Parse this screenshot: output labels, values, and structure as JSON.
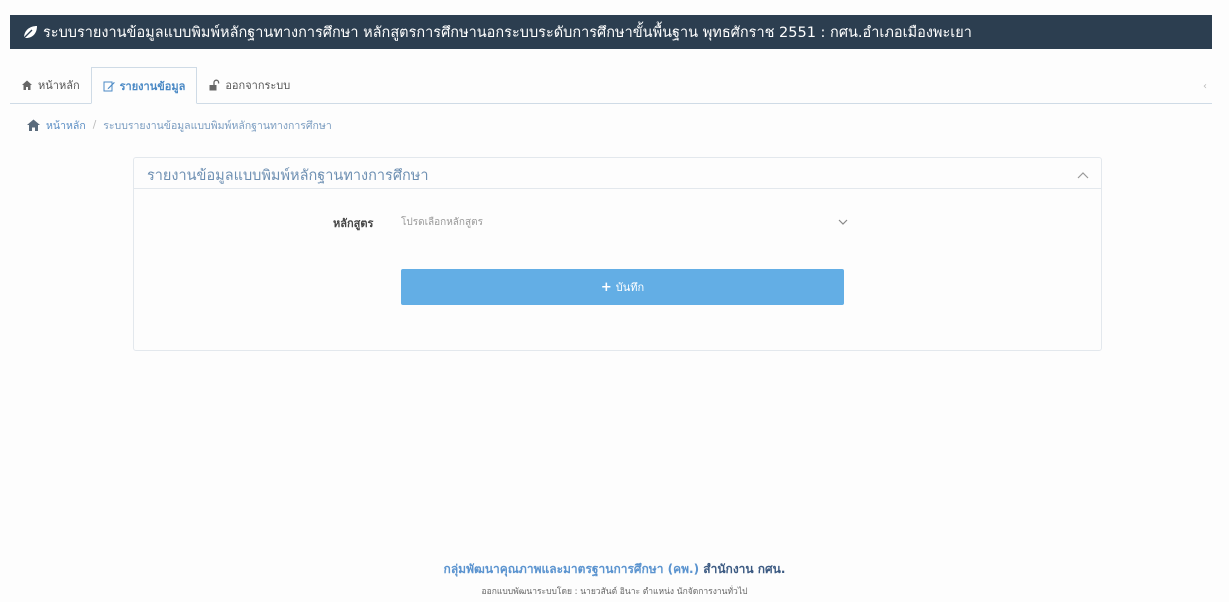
{
  "header": {
    "title": "ระบบรายงานข้อมูลแบบพิมพ์หลักฐานทางการศึกษา หลักสูตรการศึกษานอกระบบระดับการศึกษาขั้นพื้นฐาน พุทธศักราช 2551 : กศน.อำเภอเมืองพะเยา",
    "icon": "leaf-icon",
    "background": "#2c3e50"
  },
  "tabs": [
    {
      "label": "หน้าหลัก",
      "icon": "home-icon",
      "active": false
    },
    {
      "label": "รายงานข้อมูล",
      "icon": "edit-icon",
      "active": true
    },
    {
      "label": "ออกจากระบบ",
      "icon": "unlock-icon",
      "active": false
    }
  ],
  "breadcrumb": {
    "home": "หน้าหลัก",
    "separator": "/",
    "current": "ระบบรายงานข้อมูลแบบพิมพ์หลักฐานทางการศึกษา"
  },
  "panel": {
    "title": "รายงานข้อมูลแบบพิมพ์หลักฐานทางการศึกษา",
    "collapse_icon": "chevron-up-icon",
    "form": {
      "curriculum_label": "หลักสูตร",
      "curriculum_placeholder": "โปรดเลือกหลักสูตร"
    },
    "save_button": {
      "icon": "+",
      "label": "บันทึก",
      "color": "#63aee5"
    }
  },
  "footer": {
    "org": "กลุ่มพัฒนาคุณภาพและมาตรฐานการศึกษา (คพ.)",
    "office": "สำนักงาน กศน.",
    "credit": "ออกแบบพัฒนาระบบโดย : นายวสันต์ อินาะ ตำแหน่ง นักจัดการงานทั่วไป"
  }
}
